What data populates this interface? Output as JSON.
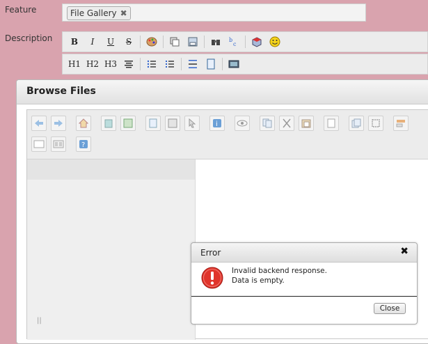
{
  "form": {
    "feature_label": "Feature",
    "description_label": "Description",
    "feature_tag": "File Gallery",
    "feature_tag_remove": "✖"
  },
  "editor_toolbar": {
    "row1": [
      "B",
      "I",
      "U",
      "S"
    ],
    "row2": [
      "H1",
      "H2",
      "H3"
    ]
  },
  "browse_dialog": {
    "title": "Browse Files"
  },
  "file_manager": {
    "resize_handle": "||"
  },
  "error_dialog": {
    "title": "Error",
    "close_icon": "✖",
    "message_line1": "Invalid backend response.",
    "message_line2": "Data is empty.",
    "close_label": "Close"
  },
  "colors": {
    "page_bg": "#d9a3ae",
    "error_red": "#e0342b"
  }
}
